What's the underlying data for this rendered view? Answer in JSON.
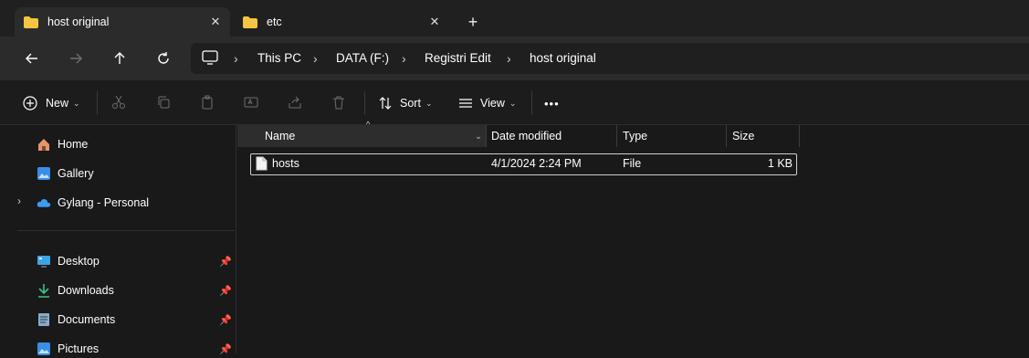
{
  "tabs": [
    {
      "label": "host original",
      "active": true
    },
    {
      "label": "etc",
      "active": false
    }
  ],
  "new_tab_label": "+",
  "breadcrumb": [
    "This PC",
    "DATA (F:)",
    "Registri Edit",
    "host original"
  ],
  "toolbar": {
    "new_label": "New",
    "sort_label": "Sort",
    "view_label": "View",
    "more_label": "•••"
  },
  "sidebar": {
    "items": [
      {
        "label": "Home",
        "icon": "home-icon"
      },
      {
        "label": "Gallery",
        "icon": "gallery-icon"
      },
      {
        "label": "Gylang - Personal",
        "icon": "onedrive-icon"
      }
    ],
    "quick_access": [
      {
        "label": "Desktop",
        "icon": "desktop-icon"
      },
      {
        "label": "Downloads",
        "icon": "download-icon"
      },
      {
        "label": "Documents",
        "icon": "documents-icon"
      },
      {
        "label": "Pictures",
        "icon": "pictures-icon"
      }
    ]
  },
  "columns": [
    "Name",
    "Date modified",
    "Type",
    "Size"
  ],
  "files": [
    {
      "name": "hosts",
      "date": "4/1/2024 2:24 PM",
      "type": "File",
      "size": "1 KB"
    }
  ],
  "colors": {
    "folder": "#f4c542",
    "accent": "#4cc2ff",
    "background": "#191919"
  }
}
